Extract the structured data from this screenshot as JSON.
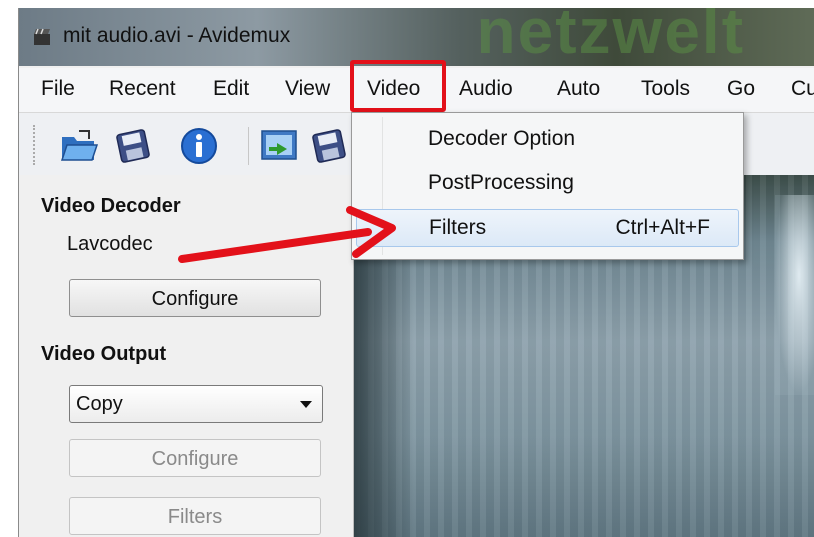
{
  "window": {
    "title": "mit audio.avi - Avidemux",
    "watermark": "netzwelt"
  },
  "menubar": {
    "items": [
      "File",
      "Recent",
      "Edit",
      "View",
      "Video",
      "Audio",
      "Auto",
      "Tools",
      "Go",
      "Cu"
    ]
  },
  "toolbar": {
    "buttons": [
      "open-icon",
      "save-icon",
      "info-icon",
      "save-video-icon",
      "save-audio-icon"
    ]
  },
  "video_menu": {
    "items": [
      {
        "label": "Decoder Option",
        "shortcut": ""
      },
      {
        "label": "PostProcessing",
        "shortcut": ""
      },
      {
        "label": "Filters",
        "shortcut": "Ctrl+Alt+F"
      }
    ]
  },
  "sidebar": {
    "video_decoder": {
      "title": "Video Decoder",
      "codec": "Lavcodec",
      "configure_label": "Configure"
    },
    "video_output": {
      "title": "Video Output",
      "selected": "Copy",
      "configure_label": "Configure",
      "filters_label": "Filters"
    }
  },
  "colors": {
    "highlight_red": "#e3111a",
    "arrow_red": "#e3111a"
  }
}
